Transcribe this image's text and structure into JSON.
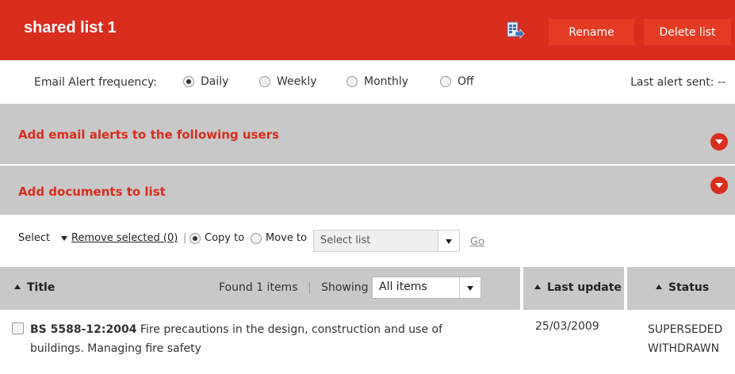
{
  "header": {
    "title": "shared list 1",
    "rename_label": "Rename",
    "delete_label": "Delete list",
    "export_icon": "export-document-icon",
    "accent": "#d92d1e"
  },
  "alerts": {
    "label": "Email Alert frequency:",
    "options": [
      {
        "label": "Daily",
        "checked": true
      },
      {
        "label": "Weekly",
        "checked": false
      },
      {
        "label": "Monthly",
        "checked": false
      },
      {
        "label": "Off",
        "checked": false
      }
    ],
    "last_sent": "Last alert sent: --"
  },
  "panels": {
    "users_title": "Add email alerts to the following users",
    "documents_title": "Add documents to list",
    "toggle_icon": "chevron-down-icon"
  },
  "actions": {
    "select_label": "Select",
    "remove_label": "Remove selected (0)",
    "separator": "|",
    "copy_label": "Copy to",
    "copy_checked": true,
    "move_label": "Move to",
    "list_select_placeholder": "Select list",
    "go_label": "Go"
  },
  "table": {
    "title_header": "Title",
    "found_text": "Found 1 items",
    "separator": "|",
    "showing_label": "Showing",
    "showing_value": "All items",
    "update_header": "Last update",
    "status_header": "Status",
    "rows": [
      {
        "code": "BS 5588-12:2004",
        "description": "Fire precautions in the design, construction and use of buildings. Managing fire safety",
        "date": "25/03/2009",
        "status_1": "SUPERSEDED",
        "status_2": "WITHDRAWN"
      }
    ]
  }
}
